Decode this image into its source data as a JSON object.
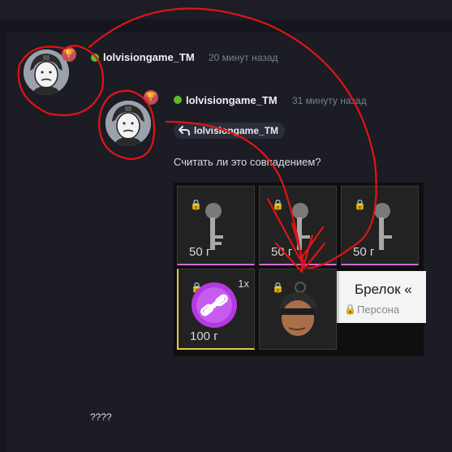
{
  "colors": {
    "background": "#15161d",
    "card": "#1b1c24",
    "online": "#5fb92f",
    "trophy_badge": "#c94a5c",
    "annotation": "#e01414"
  },
  "comment": {
    "author": "lolvisiongame_TM",
    "time": "20 минут назад",
    "avatar_icon": "soldier-avatar-icon",
    "badge_icon": "trophy-icon"
  },
  "reply": {
    "author": "lolvisiongame_TM",
    "time": "31 минуту назад",
    "reply_to": "lolvisiongame_TM",
    "reply_icon": "reply-arrow-icon",
    "text": "Считать ли это совпадением?"
  },
  "screenshot": {
    "items": [
      {
        "price": "50 г",
        "icon": "key-icon"
      },
      {
        "price": "50 г",
        "icon": "key-icon"
      },
      {
        "price": "50 г",
        "icon": "key-icon"
      },
      {
        "price": "100 г",
        "qty": "1x",
        "icon": "chain-link-icon"
      },
      {
        "price": "",
        "icon": "keychain-figure-icon"
      }
    ],
    "tooltip_title": "Брелок «",
    "tooltip_sub": "Персона"
  },
  "footer_text": "????"
}
